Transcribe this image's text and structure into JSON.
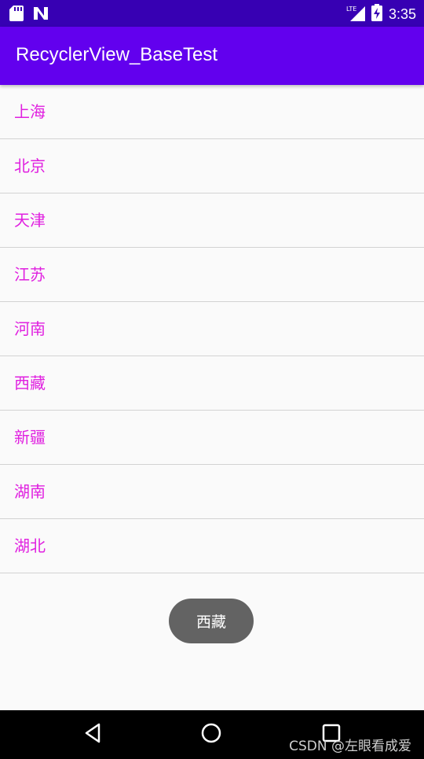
{
  "status_bar": {
    "time": "3:35",
    "network": "LTE",
    "icons": [
      "sd-card-icon",
      "n-logo-icon",
      "lte-signal-icon",
      "battery-charging-icon"
    ]
  },
  "app_bar": {
    "title": "RecyclerView_BaseTest",
    "background": "#6200ee"
  },
  "list": {
    "item_color": "#e020e0",
    "items": [
      "上海",
      "北京",
      "天津",
      "江苏",
      "河南",
      "西藏",
      "新疆",
      "湖南",
      "湖北"
    ]
  },
  "toast": {
    "text": "西藏"
  },
  "nav_bar": {
    "buttons": [
      "back-icon",
      "home-icon",
      "recents-icon"
    ]
  },
  "watermark": {
    "text": "CSDN @左眼看成爱"
  }
}
